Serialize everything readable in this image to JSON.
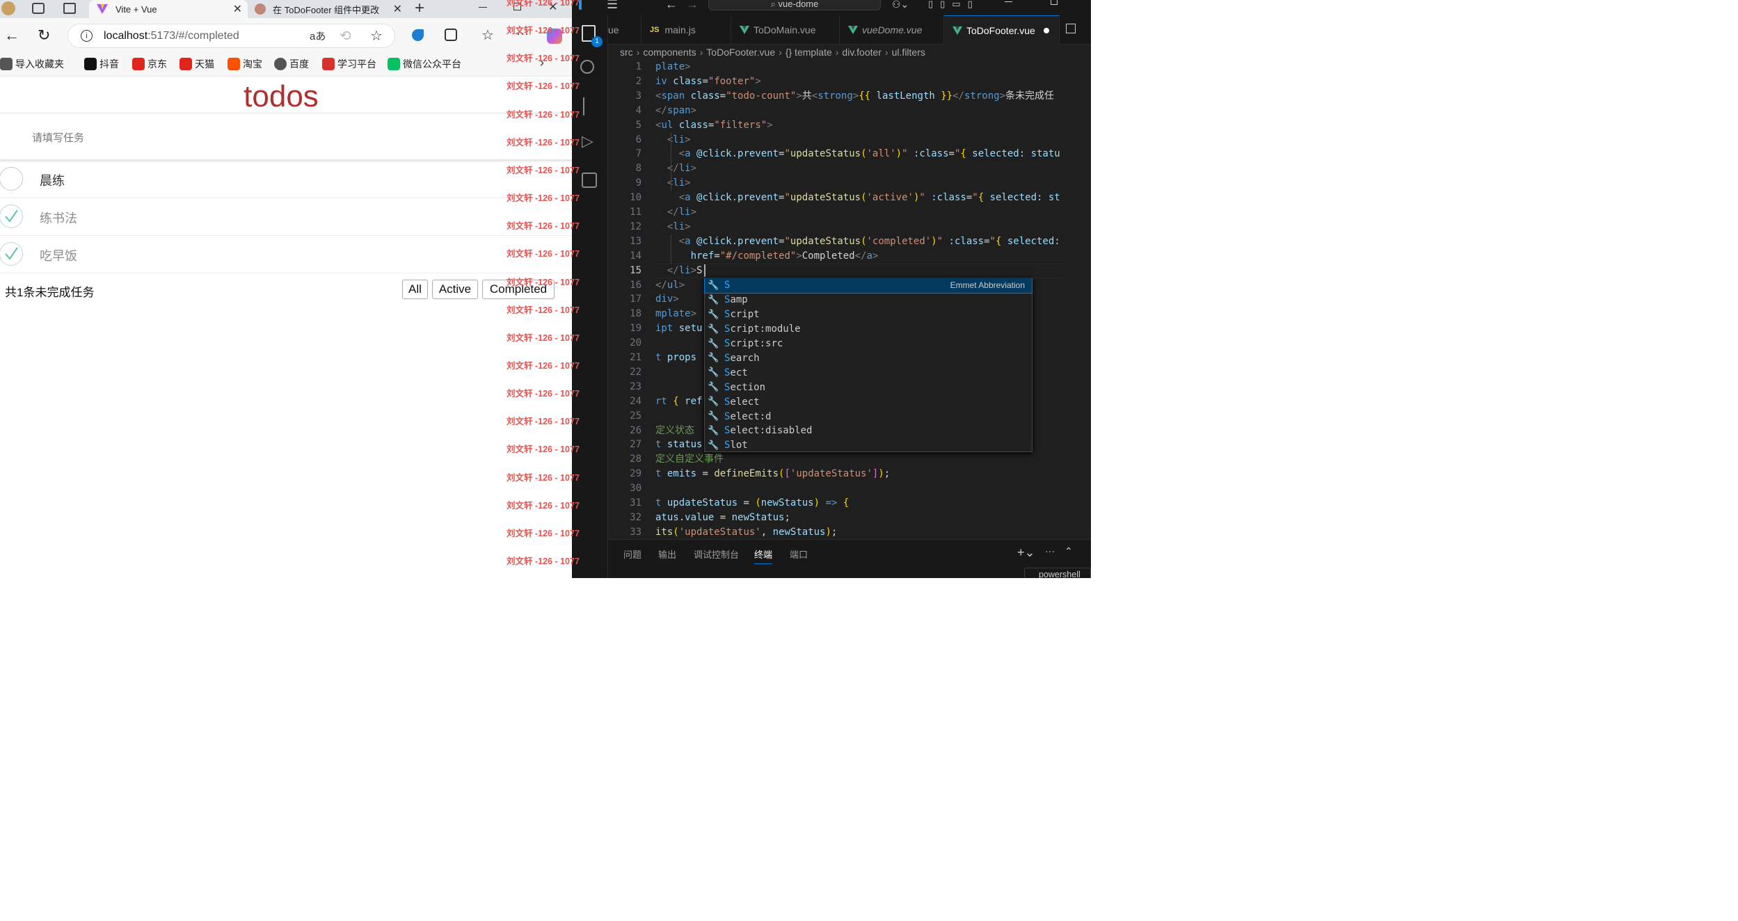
{
  "browser": {
    "tabs": [
      {
        "title": "Vite + Vue",
        "active": true
      },
      {
        "title": "在 ToDoFooter 组件中更改",
        "active": false
      }
    ],
    "url": {
      "host": "localhost",
      "rest": ":5173/#/completed"
    },
    "bookmarks": [
      {
        "label": "导入收藏夹",
        "icon": "import-icon",
        "color": "#555555"
      },
      {
        "label": "抖音",
        "icon": "douyin-icon",
        "color": "#111111"
      },
      {
        "label": "京东",
        "icon": "jd-icon",
        "color": "#e1251b"
      },
      {
        "label": "天猫",
        "icon": "tmall-icon",
        "color": "#e1251b"
      },
      {
        "label": "淘宝",
        "icon": "taobao-icon",
        "color": "#ff5000"
      },
      {
        "label": "百度",
        "icon": "globe-icon",
        "color": "#555555"
      },
      {
        "label": "学习平台",
        "icon": "xuexi-icon",
        "color": "#d9312b"
      },
      {
        "label": "微信公众平台",
        "icon": "wechat-icon",
        "color": "#07c160"
      }
    ]
  },
  "todo_app": {
    "title": "todos",
    "input_placeholder": "请填写任务",
    "items": [
      {
        "text": "晨练",
        "done": false
      },
      {
        "text": "练书法",
        "done": true
      },
      {
        "text": "吃早饭",
        "done": true
      }
    ],
    "footer_text": "共1条未完成任务",
    "filters": [
      "All",
      "Active",
      "Completed"
    ],
    "accent_color": "#af2f2f"
  },
  "watermark": {
    "text": "刘文轩 -126 - 1077",
    "color": "#e4534f"
  },
  "vscode": {
    "search_label": "vue-dome",
    "scm_badge": "1",
    "tabs": [
      {
        "label": "ue",
        "kind": "vue"
      },
      {
        "label": "main.js",
        "kind": "js"
      },
      {
        "label": "ToDoMain.vue",
        "kind": "vue"
      },
      {
        "label": "vueDome.vue",
        "kind": "vue"
      },
      {
        "label": "ToDoFooter.vue",
        "kind": "vue",
        "active": true,
        "modified": true
      }
    ],
    "breadcrumb": [
      "src",
      "components",
      "ToDoFooter.vue",
      "{} template",
      "div.footer",
      "ul.filters"
    ],
    "line_numbers": [
      "1",
      "2",
      "3",
      "4",
      "5",
      "6",
      "7",
      "8",
      "9",
      "10",
      "11",
      "12",
      "13",
      "14",
      "15",
      "16",
      "17",
      "18",
      "19",
      "20",
      "21",
      "22",
      "23",
      "24",
      "25",
      "26",
      "27",
      "28",
      "29",
      "30",
      "31",
      "32",
      "33"
    ],
    "code_lines": [
      [
        [
          "t",
          "plate"
        ],
        [
          "p",
          ">"
        ]
      ],
      [
        [
          "t",
          "iv "
        ],
        [
          "a",
          "class"
        ],
        [
          "g",
          "="
        ],
        [
          "s",
          "\"footer\""
        ],
        [
          "p",
          ">"
        ]
      ],
      [
        [
          "p",
          "<"
        ],
        [
          "t",
          "span "
        ],
        [
          "a",
          "class"
        ],
        [
          "g",
          "="
        ],
        [
          "s",
          "\"todo-count\""
        ],
        [
          "p",
          ">"
        ],
        [
          "g",
          "共"
        ],
        [
          "p",
          "<"
        ],
        [
          "t",
          "strong"
        ],
        [
          "p",
          ">"
        ],
        [
          "y",
          "{{ "
        ],
        [
          "v",
          "lastLength"
        ],
        [
          "y",
          " }}"
        ],
        [
          "p",
          "</"
        ],
        [
          "t",
          "strong"
        ],
        [
          "p",
          ">"
        ],
        [
          "g",
          "条未完成任"
        ]
      ],
      [
        [
          "p",
          "</"
        ],
        [
          "t",
          "span"
        ],
        [
          "p",
          ">"
        ]
      ],
      [
        [
          "p",
          "<"
        ],
        [
          "t",
          "ul "
        ],
        [
          "a",
          "class"
        ],
        [
          "g",
          "="
        ],
        [
          "s",
          "\"filters\""
        ],
        [
          "p",
          ">"
        ]
      ],
      [
        [
          "g",
          "  "
        ],
        [
          "p",
          "<"
        ],
        [
          "t",
          "li"
        ],
        [
          "p",
          ">"
        ]
      ],
      [
        [
          "g",
          "    "
        ],
        [
          "p",
          "<"
        ],
        [
          "t",
          "a "
        ],
        [
          "a",
          "@click.prevent"
        ],
        [
          "g",
          "="
        ],
        [
          "s",
          "\""
        ],
        [
          "f",
          "updateStatus"
        ],
        [
          "y",
          "("
        ],
        [
          "s",
          "'all'"
        ],
        [
          "y",
          ")"
        ],
        [
          "s",
          "\""
        ],
        [
          "g",
          " "
        ],
        [
          "a",
          ":class"
        ],
        [
          "g",
          "="
        ],
        [
          "s",
          "\""
        ],
        [
          "y",
          "{ "
        ],
        [
          "v",
          "selected"
        ],
        [
          "g",
          ": "
        ],
        [
          "v",
          "statu"
        ]
      ],
      [
        [
          "g",
          "  "
        ],
        [
          "p",
          "</"
        ],
        [
          "t",
          "li"
        ],
        [
          "p",
          ">"
        ]
      ],
      [
        [
          "g",
          "  "
        ],
        [
          "p",
          "<"
        ],
        [
          "t",
          "li"
        ],
        [
          "p",
          ">"
        ]
      ],
      [
        [
          "g",
          "    "
        ],
        [
          "p",
          "<"
        ],
        [
          "t",
          "a "
        ],
        [
          "a",
          "@click.prevent"
        ],
        [
          "g",
          "="
        ],
        [
          "s",
          "\""
        ],
        [
          "f",
          "updateStatus"
        ],
        [
          "y",
          "("
        ],
        [
          "s",
          "'active'"
        ],
        [
          "y",
          ")"
        ],
        [
          "s",
          "\""
        ],
        [
          "g",
          " "
        ],
        [
          "a",
          ":class"
        ],
        [
          "g",
          "="
        ],
        [
          "s",
          "\""
        ],
        [
          "y",
          "{ "
        ],
        [
          "v",
          "selected"
        ],
        [
          "g",
          ": "
        ],
        [
          "v",
          "st"
        ]
      ],
      [
        [
          "g",
          "  "
        ],
        [
          "p",
          "</"
        ],
        [
          "t",
          "li"
        ],
        [
          "p",
          ">"
        ]
      ],
      [
        [
          "g",
          "  "
        ],
        [
          "p",
          "<"
        ],
        [
          "t",
          "li"
        ],
        [
          "p",
          ">"
        ]
      ],
      [
        [
          "g",
          "    "
        ],
        [
          "p",
          "<"
        ],
        [
          "t",
          "a "
        ],
        [
          "a",
          "@click.prevent"
        ],
        [
          "g",
          "="
        ],
        [
          "s",
          "\""
        ],
        [
          "f",
          "updateStatus"
        ],
        [
          "y",
          "("
        ],
        [
          "s",
          "'completed'"
        ],
        [
          "y",
          ")"
        ],
        [
          "s",
          "\""
        ],
        [
          "g",
          " "
        ],
        [
          "a",
          ":class"
        ],
        [
          "g",
          "="
        ],
        [
          "s",
          "\""
        ],
        [
          "y",
          "{ "
        ],
        [
          "v",
          "selected:"
        ]
      ],
      [
        [
          "g",
          "      "
        ],
        [
          "a",
          "href"
        ],
        [
          "g",
          "="
        ],
        [
          "s",
          "\"#/completed\""
        ],
        [
          "p",
          ">"
        ],
        [
          "g",
          "Completed"
        ],
        [
          "p",
          "</"
        ],
        [
          "t",
          "a"
        ],
        [
          "p",
          ">"
        ]
      ],
      [
        [
          "g",
          "  "
        ],
        [
          "p",
          "</"
        ],
        [
          "t",
          "li"
        ],
        [
          "p",
          ">"
        ],
        [
          "g",
          "S"
        ]
      ],
      [
        [
          "p",
          "</"
        ],
        [
          "t",
          "ul"
        ],
        [
          "p",
          ">"
        ]
      ],
      [
        [
          "t",
          "div"
        ],
        [
          "p",
          ">"
        ]
      ],
      [
        [
          "t",
          "mplate"
        ],
        [
          "p",
          ">"
        ]
      ],
      [
        [
          "t",
          "ipt "
        ],
        [
          "a",
          "setu"
        ]
      ],
      [
        [
          "g",
          ""
        ]
      ],
      [
        [
          "k",
          "t "
        ],
        [
          "v",
          "props"
        ]
      ],
      [
        [
          "g",
          ""
        ]
      ],
      [
        [
          "g",
          ""
        ]
      ],
      [
        [
          "k",
          "rt "
        ],
        [
          "y",
          "{ "
        ],
        [
          "v",
          "ref"
        ]
      ],
      [
        [
          "g",
          ""
        ]
      ],
      [
        [
          "c",
          "定义状态"
        ]
      ],
      [
        [
          "k",
          "t "
        ],
        [
          "v",
          "status"
        ]
      ],
      [
        [
          "c",
          "定义自定义事件"
        ]
      ],
      [
        [
          "k",
          "t "
        ],
        [
          "v",
          "emits"
        ],
        [
          "g",
          " = "
        ],
        [
          "f",
          "defineEmits"
        ],
        [
          "y",
          "("
        ],
        [
          "pk",
          "["
        ],
        [
          "s",
          "'updateStatus'"
        ],
        [
          "pk",
          "]"
        ],
        [
          "y",
          ")"
        ],
        [
          "g",
          ";"
        ]
      ],
      [
        [
          "g",
          ""
        ]
      ],
      [
        [
          "k",
          "t "
        ],
        [
          "v",
          "updateStatus"
        ],
        [
          "g",
          " = "
        ],
        [
          "y",
          "("
        ],
        [
          "v",
          "newStatus"
        ],
        [
          "y",
          ")"
        ],
        [
          "g",
          " "
        ],
        [
          "k",
          "=>"
        ],
        [
          "g",
          " "
        ],
        [
          "y",
          "{"
        ]
      ],
      [
        [
          "v",
          "atus"
        ],
        [
          "g",
          "."
        ],
        [
          "v",
          "value"
        ],
        [
          "g",
          " = "
        ],
        [
          "v",
          "newStatus"
        ],
        [
          "g",
          ";"
        ]
      ],
      [
        [
          "f",
          "its"
        ],
        [
          "y",
          "("
        ],
        [
          "s",
          "'updateStatus'"
        ],
        [
          "g",
          ", "
        ],
        [
          "v",
          "newStatus"
        ],
        [
          "y",
          ")"
        ],
        [
          "g",
          ";"
        ]
      ]
    ],
    "suggestions": [
      {
        "match": "S",
        "rest": "",
        "detail": "Emmet Abbreviation"
      },
      {
        "match": "S",
        "rest": "amp"
      },
      {
        "match": "S",
        "rest": "cript"
      },
      {
        "match": "S",
        "rest": "cript:module"
      },
      {
        "match": "S",
        "rest": "cript:src"
      },
      {
        "match": "S",
        "rest": "earch"
      },
      {
        "match": "S",
        "rest": "ect"
      },
      {
        "match": "S",
        "rest": "ection"
      },
      {
        "match": "S",
        "rest": "elect"
      },
      {
        "match": "S",
        "rest": "elect:d"
      },
      {
        "match": "S",
        "rest": "elect:disabled"
      },
      {
        "match": "S",
        "rest": "lot"
      }
    ],
    "panel_tabs": [
      "问题",
      "输出",
      "调试控制台",
      "终端",
      "端口"
    ],
    "active_panel_tab": "终端",
    "terminal_label": "powershell"
  }
}
